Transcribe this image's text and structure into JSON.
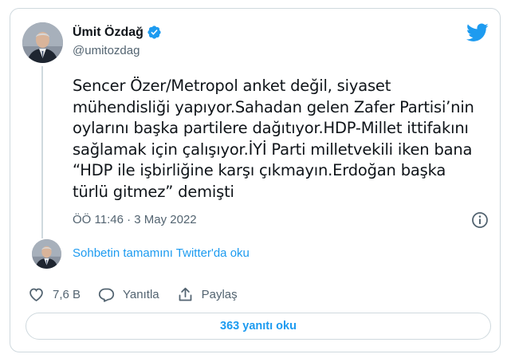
{
  "author": {
    "name": "Ümit Özdağ",
    "handle": "@umitozdag",
    "verified": true
  },
  "tweet": {
    "text": "Sencer Özer/Metropol anket değil, siyaset\nmühendisliği yapıyor.Sahadan gelen Zafer Partisi’nin\noylarını başka partilere dağıtıyor.HDP-Millet ittifakını\nsağlamak için çalışıyor.İYİ Parti milletvekili iken bana\n“HDP ile işbirliğine karşı çıkmayın.Erdoğan başka\ntürlü gitmez” demişti",
    "timestamp": "ÖÖ 11:46 · 3 May 2022"
  },
  "conversation": {
    "link_label": "Sohbetin tamamını Twitter'da oku"
  },
  "actions": {
    "like_count": "7,6 B",
    "reply_label": "Yanıtla",
    "share_label": "Paylaş"
  },
  "replies_button": {
    "label": "363 yanıtı oku"
  },
  "colors": {
    "accent": "#1d9bf0",
    "text": "#0f1419",
    "secondary": "#536471",
    "border": "#cfd9de"
  },
  "icons": [
    "verified-badge-icon",
    "twitter-bird-icon",
    "info-icon",
    "heart-icon",
    "reply-icon",
    "share-icon"
  ]
}
